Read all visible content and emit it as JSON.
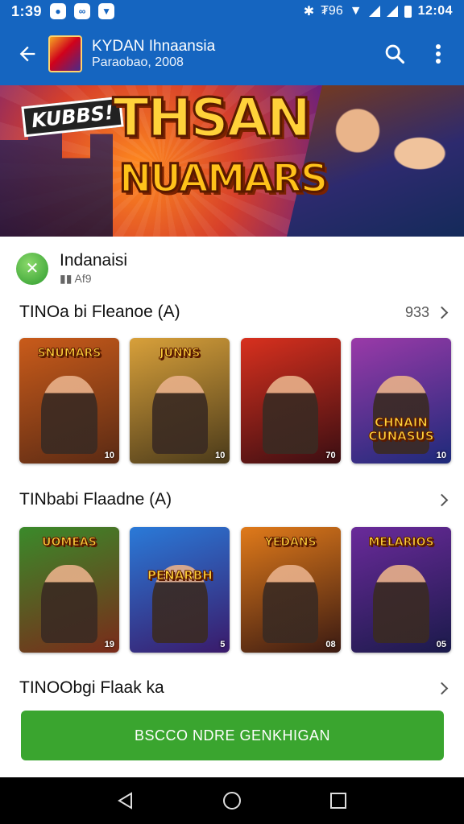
{
  "status_bar": {
    "time_left": "1:39",
    "notif_icons": [
      "messenger-icon",
      "link-icon",
      "shield-icon"
    ],
    "right_text": "₮96",
    "time_right": "12:04"
  },
  "app_bar": {
    "title": "KYDAN Ihnaansia",
    "subtitle": "Paraobao, 2008"
  },
  "hero": {
    "tag": "KUBBS!",
    "title_line1": "THSAN",
    "title_line2": "NUAMARS"
  },
  "developer": {
    "name": "Indanaisi",
    "meta": "Af9"
  },
  "sections": [
    {
      "title": "TINOa bi Fleanoe (A)",
      "count": "933",
      "games": [
        {
          "title": "SNUMARS",
          "badge": "10",
          "title_pos": "top",
          "colors": [
            "#c95b1a",
            "#5a2a14"
          ]
        },
        {
          "title": "JUNNS",
          "badge": "10",
          "title_pos": "top",
          "colors": [
            "#d8a03a",
            "#4a3a1a"
          ]
        },
        {
          "title": "",
          "badge": "70",
          "title_pos": "top",
          "colors": [
            "#d8301e",
            "#3a0e12"
          ]
        },
        {
          "title": "CHNAIN CUNASUS",
          "badge": "10",
          "title_pos": "bottom",
          "colors": [
            "#9a3aa8",
            "#1d2a7a"
          ]
        }
      ]
    },
    {
      "title": "TINbabi Flaadne (A)",
      "count": "",
      "games": [
        {
          "title": "UOMEAS",
          "badge": "19",
          "title_pos": "top",
          "colors": [
            "#3a8a2a",
            "#7a2a1a"
          ]
        },
        {
          "title": "PENARBH",
          "badge": "5",
          "title_pos": "mid",
          "colors": [
            "#2a7ad8",
            "#3a1a6a"
          ]
        },
        {
          "title": "YEDANS",
          "badge": "08",
          "title_pos": "top",
          "colors": [
            "#e07a1a",
            "#3a1a12"
          ]
        },
        {
          "title": "MELARIOS",
          "badge": "05",
          "title_pos": "top",
          "colors": [
            "#6a2a9a",
            "#1a1a4a"
          ]
        }
      ]
    },
    {
      "title": "TINOObgi Flaak ka",
      "count": "",
      "games": []
    }
  ],
  "cta": {
    "label": "BSCCO NDRE GENKHIGAN"
  }
}
